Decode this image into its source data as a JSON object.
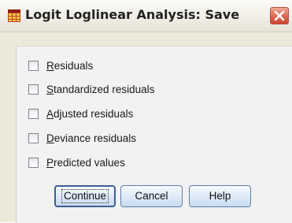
{
  "window": {
    "title": "Logit Loglinear Analysis: Save",
    "icon": "spss-grid-icon",
    "close_icon": "close-x-icon"
  },
  "checkboxes": [
    {
      "label_mnemonic": "R",
      "label_rest": "esiduals",
      "checked": false
    },
    {
      "label_mnemonic": "S",
      "label_rest": "tandardized residuals",
      "checked": false
    },
    {
      "label_mnemonic": "A",
      "label_rest": "djusted residuals",
      "checked": false
    },
    {
      "label_mnemonic": "D",
      "label_rest": "eviance residuals",
      "checked": false
    },
    {
      "label_mnemonic": "P",
      "label_rest": "redicted values",
      "checked": false
    }
  ],
  "buttons": {
    "continue": "Continue",
    "cancel": "Cancel",
    "help": "Help"
  },
  "colors": {
    "dialog_background": "#f2f2f2",
    "close_button": "#d9583f",
    "button_border": "#5f7fa8"
  }
}
